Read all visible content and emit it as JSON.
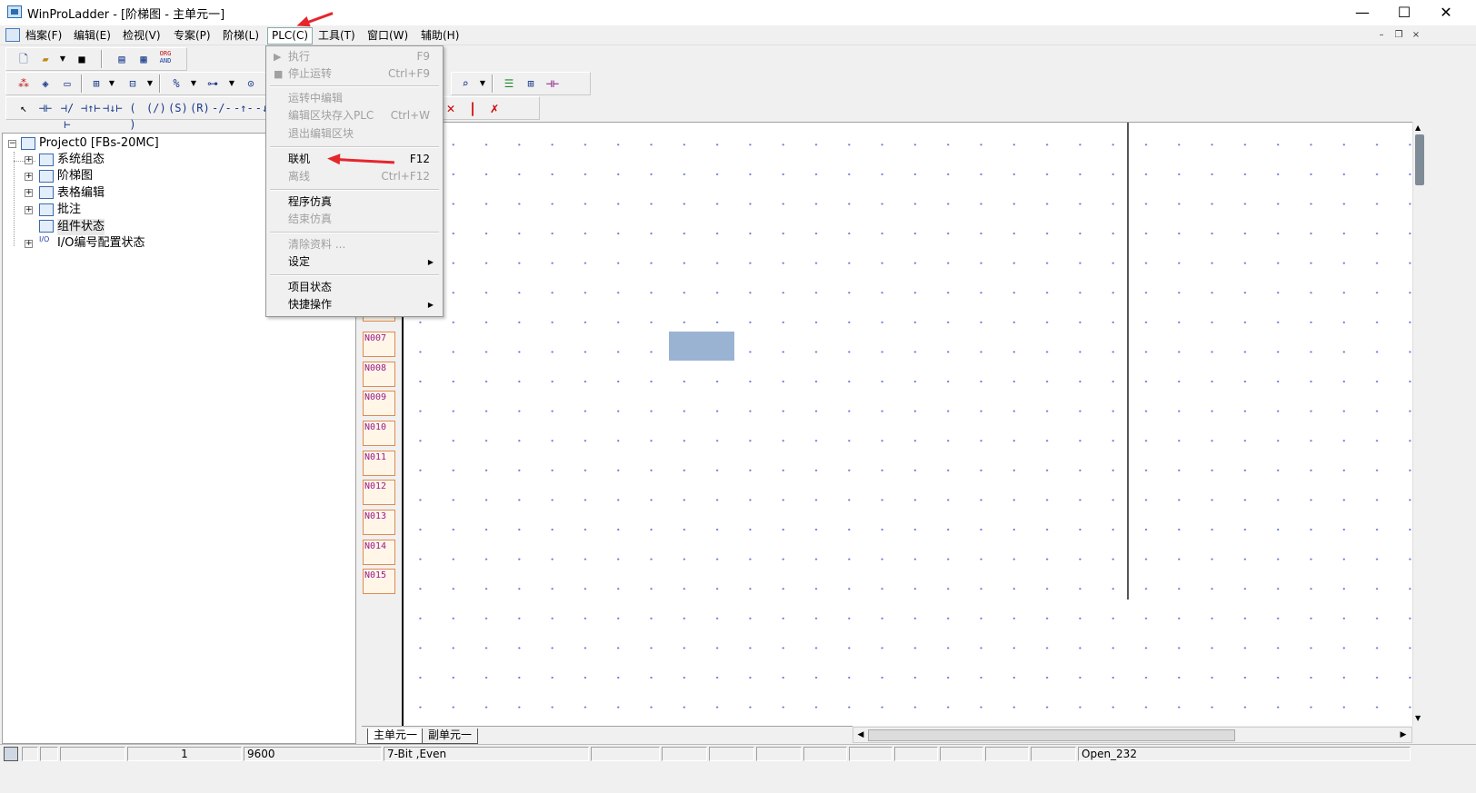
{
  "window": {
    "title": "WinProLadder - [阶梯图 - 主单元一]",
    "controls": {
      "minimize": "—",
      "maximize": "☐",
      "close": "✕"
    }
  },
  "menubar": {
    "items": [
      "档案(F)",
      "编辑(E)",
      "检视(V)",
      "专案(P)",
      "阶梯(L)",
      "PLC(C)",
      "工具(T)",
      "窗口(W)",
      "辅助(H)"
    ],
    "mdi": {
      "minimize": "–",
      "restore": "❐",
      "close": "×"
    }
  },
  "toolbar": {
    "org_and_top": "ORG",
    "org_and_bottom": "AND"
  },
  "tree": {
    "root": "Project0 [FBs-20MC]",
    "items": [
      "系统组态",
      "阶梯图",
      "表格编辑",
      "批注",
      "组件状态",
      "I/O编号配置状态"
    ],
    "io_icon": "I/O"
  },
  "plc_menu": {
    "items": [
      {
        "label": "执行",
        "key": "F9"
      },
      {
        "label": "停止运转",
        "key": "Ctrl+F9"
      },
      {
        "label": "运转中编辑",
        "key": ""
      },
      {
        "label": "编辑区块存入PLC",
        "key": "Ctrl+W"
      },
      {
        "label": "退出编辑区块",
        "key": ""
      },
      {
        "label": "联机",
        "key": "F12"
      },
      {
        "label": "离线",
        "key": "Ctrl+F12"
      },
      {
        "label": "程序仿真",
        "key": ""
      },
      {
        "label": "结束仿真",
        "key": ""
      },
      {
        "label": "清除资料 ...",
        "key": ""
      },
      {
        "label": "设定",
        "key": ""
      },
      {
        "label": "项目状态",
        "key": ""
      },
      {
        "label": "快捷操作",
        "key": ""
      }
    ]
  },
  "rungs": [
    "N007",
    "N008",
    "N009",
    "N010",
    "N011",
    "N012",
    "N013",
    "N014",
    "N015"
  ],
  "tabs": [
    "主单元一",
    "副单元一"
  ],
  "statusbar": {
    "cell1": "1",
    "baud": "9600",
    "format": "7-Bit ,Even",
    "port": "Open_232"
  },
  "colors": {
    "cursor": "#9ab3d3",
    "rung_label": "#9a1a8a",
    "annotation_arrow": "#e5262c"
  }
}
